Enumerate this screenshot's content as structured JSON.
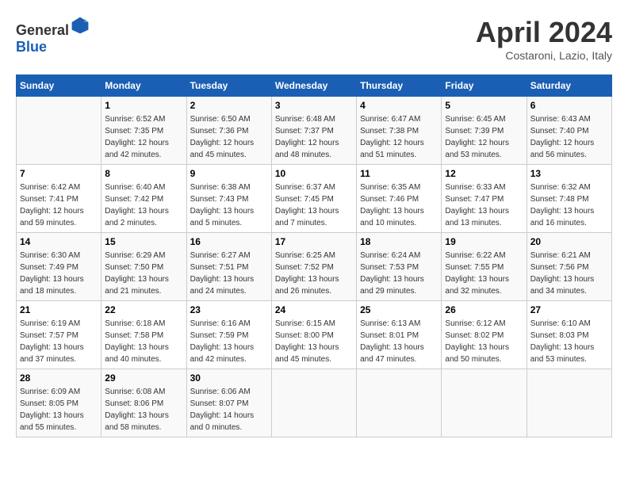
{
  "header": {
    "logo_general": "General",
    "logo_blue": "Blue",
    "title": "April 2024",
    "location": "Costaroni, Lazio, Italy"
  },
  "days_of_week": [
    "Sunday",
    "Monday",
    "Tuesday",
    "Wednesday",
    "Thursday",
    "Friday",
    "Saturday"
  ],
  "weeks": [
    [
      {
        "day": "",
        "info": ""
      },
      {
        "day": "1",
        "info": "Sunrise: 6:52 AM\nSunset: 7:35 PM\nDaylight: 12 hours\nand 42 minutes."
      },
      {
        "day": "2",
        "info": "Sunrise: 6:50 AM\nSunset: 7:36 PM\nDaylight: 12 hours\nand 45 minutes."
      },
      {
        "day": "3",
        "info": "Sunrise: 6:48 AM\nSunset: 7:37 PM\nDaylight: 12 hours\nand 48 minutes."
      },
      {
        "day": "4",
        "info": "Sunrise: 6:47 AM\nSunset: 7:38 PM\nDaylight: 12 hours\nand 51 minutes."
      },
      {
        "day": "5",
        "info": "Sunrise: 6:45 AM\nSunset: 7:39 PM\nDaylight: 12 hours\nand 53 minutes."
      },
      {
        "day": "6",
        "info": "Sunrise: 6:43 AM\nSunset: 7:40 PM\nDaylight: 12 hours\nand 56 minutes."
      }
    ],
    [
      {
        "day": "7",
        "info": "Sunrise: 6:42 AM\nSunset: 7:41 PM\nDaylight: 12 hours\nand 59 minutes."
      },
      {
        "day": "8",
        "info": "Sunrise: 6:40 AM\nSunset: 7:42 PM\nDaylight: 13 hours\nand 2 minutes."
      },
      {
        "day": "9",
        "info": "Sunrise: 6:38 AM\nSunset: 7:43 PM\nDaylight: 13 hours\nand 5 minutes."
      },
      {
        "day": "10",
        "info": "Sunrise: 6:37 AM\nSunset: 7:45 PM\nDaylight: 13 hours\nand 7 minutes."
      },
      {
        "day": "11",
        "info": "Sunrise: 6:35 AM\nSunset: 7:46 PM\nDaylight: 13 hours\nand 10 minutes."
      },
      {
        "day": "12",
        "info": "Sunrise: 6:33 AM\nSunset: 7:47 PM\nDaylight: 13 hours\nand 13 minutes."
      },
      {
        "day": "13",
        "info": "Sunrise: 6:32 AM\nSunset: 7:48 PM\nDaylight: 13 hours\nand 16 minutes."
      }
    ],
    [
      {
        "day": "14",
        "info": "Sunrise: 6:30 AM\nSunset: 7:49 PM\nDaylight: 13 hours\nand 18 minutes."
      },
      {
        "day": "15",
        "info": "Sunrise: 6:29 AM\nSunset: 7:50 PM\nDaylight: 13 hours\nand 21 minutes."
      },
      {
        "day": "16",
        "info": "Sunrise: 6:27 AM\nSunset: 7:51 PM\nDaylight: 13 hours\nand 24 minutes."
      },
      {
        "day": "17",
        "info": "Sunrise: 6:25 AM\nSunset: 7:52 PM\nDaylight: 13 hours\nand 26 minutes."
      },
      {
        "day": "18",
        "info": "Sunrise: 6:24 AM\nSunset: 7:53 PM\nDaylight: 13 hours\nand 29 minutes."
      },
      {
        "day": "19",
        "info": "Sunrise: 6:22 AM\nSunset: 7:55 PM\nDaylight: 13 hours\nand 32 minutes."
      },
      {
        "day": "20",
        "info": "Sunrise: 6:21 AM\nSunset: 7:56 PM\nDaylight: 13 hours\nand 34 minutes."
      }
    ],
    [
      {
        "day": "21",
        "info": "Sunrise: 6:19 AM\nSunset: 7:57 PM\nDaylight: 13 hours\nand 37 minutes."
      },
      {
        "day": "22",
        "info": "Sunrise: 6:18 AM\nSunset: 7:58 PM\nDaylight: 13 hours\nand 40 minutes."
      },
      {
        "day": "23",
        "info": "Sunrise: 6:16 AM\nSunset: 7:59 PM\nDaylight: 13 hours\nand 42 minutes."
      },
      {
        "day": "24",
        "info": "Sunrise: 6:15 AM\nSunset: 8:00 PM\nDaylight: 13 hours\nand 45 minutes."
      },
      {
        "day": "25",
        "info": "Sunrise: 6:13 AM\nSunset: 8:01 PM\nDaylight: 13 hours\nand 47 minutes."
      },
      {
        "day": "26",
        "info": "Sunrise: 6:12 AM\nSunset: 8:02 PM\nDaylight: 13 hours\nand 50 minutes."
      },
      {
        "day": "27",
        "info": "Sunrise: 6:10 AM\nSunset: 8:03 PM\nDaylight: 13 hours\nand 53 minutes."
      }
    ],
    [
      {
        "day": "28",
        "info": "Sunrise: 6:09 AM\nSunset: 8:05 PM\nDaylight: 13 hours\nand 55 minutes."
      },
      {
        "day": "29",
        "info": "Sunrise: 6:08 AM\nSunset: 8:06 PM\nDaylight: 13 hours\nand 58 minutes."
      },
      {
        "day": "30",
        "info": "Sunrise: 6:06 AM\nSunset: 8:07 PM\nDaylight: 14 hours\nand 0 minutes."
      },
      {
        "day": "",
        "info": ""
      },
      {
        "day": "",
        "info": ""
      },
      {
        "day": "",
        "info": ""
      },
      {
        "day": "",
        "info": ""
      }
    ]
  ]
}
